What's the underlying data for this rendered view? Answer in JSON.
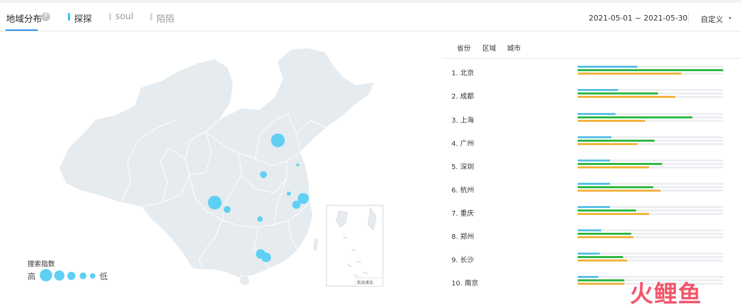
{
  "header": {
    "title": "地域分布",
    "help_icon": "?",
    "legend": [
      {
        "label": "探探",
        "color": "#2ec6f3",
        "text_color": "#333333"
      },
      {
        "label": "soul",
        "color": "#d9d9d9",
        "text_color": "#999999"
      },
      {
        "label": "陌陌",
        "color": "#d9d9d9",
        "text_color": "#999999"
      }
    ],
    "date_range": "2021-05-01 ~ 2021-05-30",
    "custom_label": "自定义",
    "caret_icon": "▾"
  },
  "map": {
    "inset_label": "南海诸岛",
    "bubble_color": "#5fd0f4",
    "legend": {
      "title": "搜索指数",
      "high": "高",
      "low": "低"
    }
  },
  "ranking": {
    "tabs": [
      "省份",
      "区域",
      "城市"
    ],
    "series_colors": [
      "#5bc0e8",
      "#2db843",
      "#f2b33d"
    ],
    "items": [
      {
        "label": "1.  北京",
        "values": [
          0.41,
          1.0,
          0.71
        ]
      },
      {
        "label": "2.  成都",
        "values": [
          0.28,
          0.55,
          0.67
        ]
      },
      {
        "label": "3.  上海",
        "values": [
          0.26,
          0.79,
          0.46
        ]
      },
      {
        "label": "4.  广州",
        "values": [
          0.23,
          0.53,
          0.41
        ]
      },
      {
        "label": "5.  深圳",
        "values": [
          0.22,
          0.58,
          0.49
        ]
      },
      {
        "label": "6.  杭州",
        "values": [
          0.22,
          0.52,
          0.57
        ]
      },
      {
        "label": "7.  重庆",
        "values": [
          0.22,
          0.4,
          0.49
        ]
      },
      {
        "label": "8.  郑州",
        "values": [
          0.16,
          0.37,
          0.38
        ]
      },
      {
        "label": "9.  长沙",
        "values": [
          0.15,
          0.31,
          0.34
        ]
      },
      {
        "label": "10. 南京",
        "values": [
          0.14,
          0.32,
          0.32
        ]
      }
    ]
  },
  "watermark": "火鲤鱼"
}
